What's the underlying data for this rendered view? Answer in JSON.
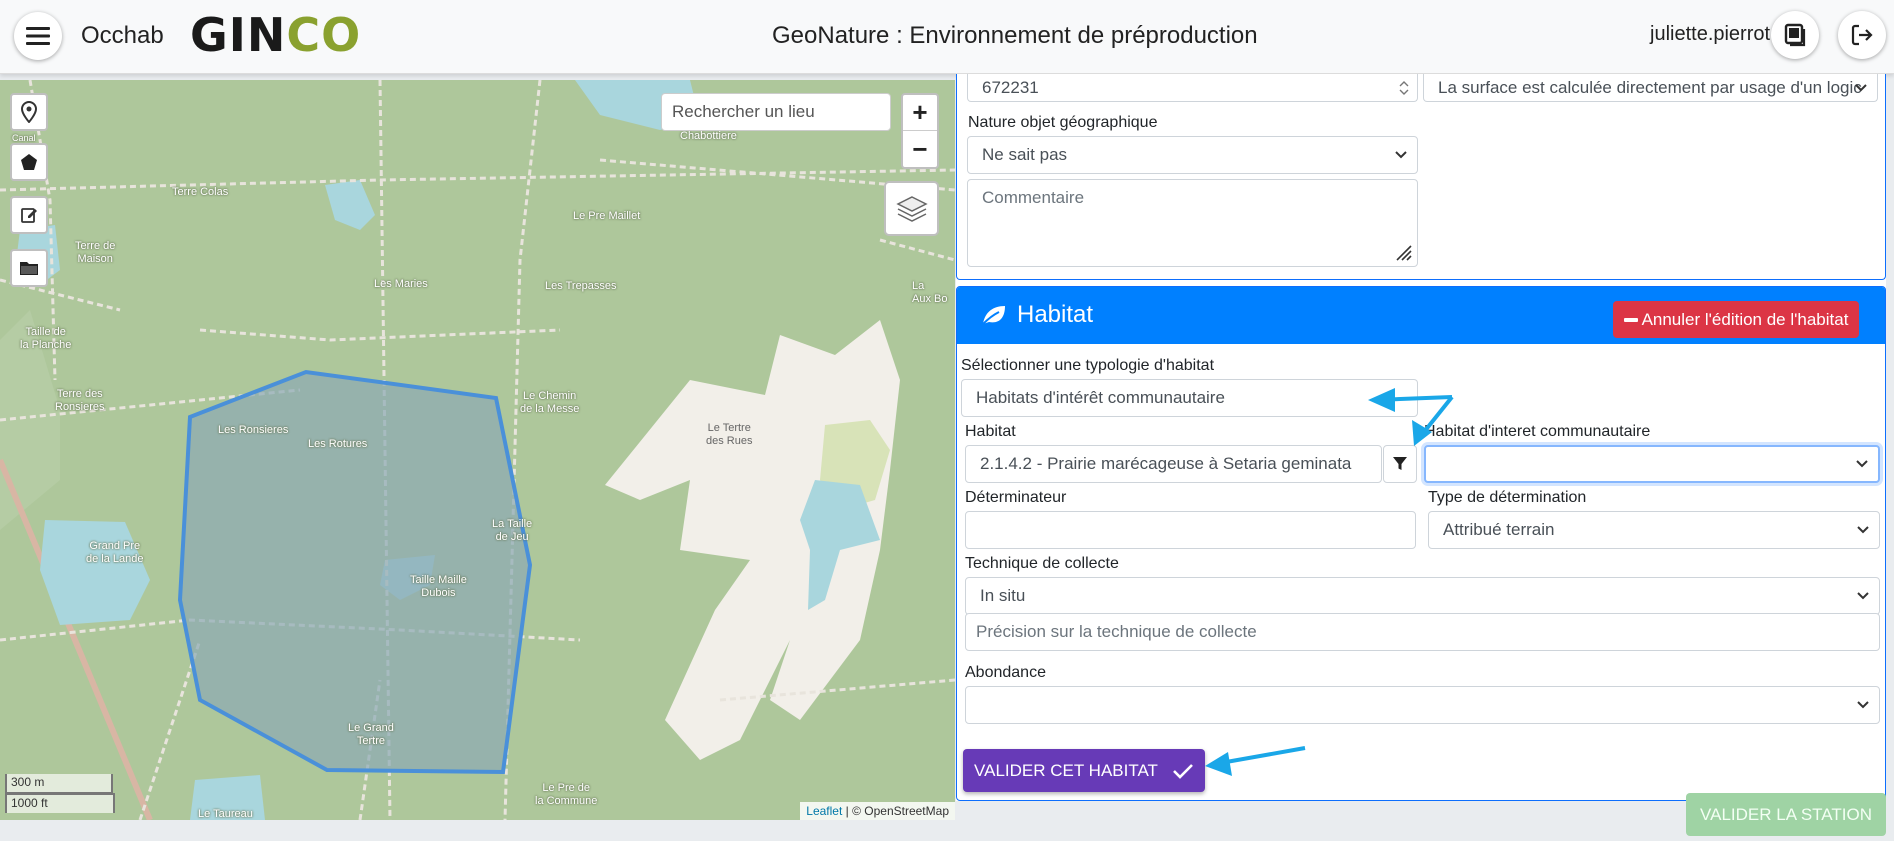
{
  "header": {
    "app_name": "Occhab",
    "logo_text_main": "GIN",
    "logo_text_accent": "CO",
    "environment_title": "GeoNature : Environnement de préproduction",
    "username": "juliette.pierrot"
  },
  "icons": {
    "menu": "hamburger-icon",
    "docs": "book-icon",
    "logout": "logout-icon",
    "marker": "marker-icon",
    "polygon": "polygon-icon",
    "edit": "edit-icon",
    "folder": "folder-icon",
    "layers": "layers-icon",
    "habitat": "leaf-icon",
    "filter": "filter-icon",
    "check": "check-icon"
  },
  "map": {
    "search_placeholder": "Rechercher un lieu",
    "zoom_in": "+",
    "zoom_out": "−",
    "scale_metric": "300 m",
    "scale_imperial": "1000 ft",
    "attribution_link": "Leaflet",
    "attribution_text": " | © OpenStreetMap",
    "labels": {
      "canal": "Canal",
      "terre_colas": "Terre Colas",
      "terre_de_maison": "Terre de\nMaison",
      "les_maries": "Les Maries",
      "le_pre_maillet": "Le Pre Maillet",
      "les_trepasses": "Les Trepasses",
      "taille_planche": "Taille de\nla Planche",
      "terre_ronsieres": "Terre des\nRonsieres",
      "les_ronsieres": "Les Ronsieres",
      "les_rotures": "Les Rotures",
      "le_chemin_messe": "Le Chemin\nde la Messe",
      "le_tertre_rues": "Le Tertre\ndes Rues",
      "la_taille_jeu": "La Taille\nde Jeu",
      "grand_pre_lande": "Grand Pre\nde la Lande",
      "taille_maille_dubois": "Taille Maille\nDubois",
      "le_grand_tertre": "Le Grand\nTertre",
      "le_pre_commune": "Le Pre de\nla Commune",
      "le_taureau": "Le Taureau",
      "chabottiere": "Chabottiere",
      "aux_bordes": "La\nAux Bo"
    }
  },
  "station_form": {
    "surface_value": "672231",
    "surface_method": "La surface est calculée directement par usage d'un logic",
    "nature_label": "Nature objet géographique",
    "nature_value": "Ne sait pas",
    "comment_placeholder": "Commentaire"
  },
  "habitat": {
    "title": "Habitat",
    "cancel_label": "Annuler l'édition de l'habitat",
    "typology_label": "Sélectionner une typologie d'habitat",
    "typology_value": "Habitats d'intérêt communautaire",
    "habitat_label": "Habitat",
    "habitat_value": "2.1.4.2 - Prairie marécageuse à Setaria geminata",
    "hic_label": "Habitat d'interet communautaire",
    "hic_value": "",
    "determinator_label": "Déterminateur",
    "determinator_value": "",
    "determination_type_label": "Type de détermination",
    "determination_type_value": "Attribué terrain",
    "technique_label": "Technique de collecte",
    "technique_value": "In situ",
    "technique_precision_placeholder": "Précision sur la technique de collecte",
    "abundance_label": "Abondance",
    "abundance_value": "",
    "validate_label": "VALIDER CET HABITAT"
  },
  "footer": {
    "validate_station_label": "VALIDER LA STATION"
  },
  "colors": {
    "primary_blue": "#0080ff",
    "danger": "#dc3545",
    "purple": "#673ab7",
    "success_disabled": "#9fd3a4",
    "annotation_arrow": "#1aa7e8",
    "map_polygon": "#4a90d9"
  }
}
